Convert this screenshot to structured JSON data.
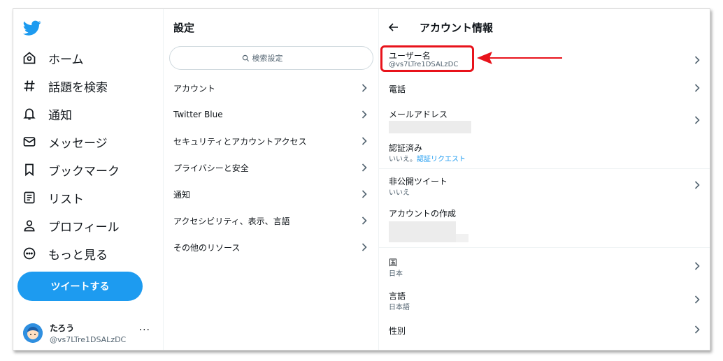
{
  "nav": {
    "items": [
      {
        "label": "ホーム",
        "icon": "home-icon"
      },
      {
        "label": "話題を検索",
        "icon": "hashtag-icon"
      },
      {
        "label": "通知",
        "icon": "bell-icon"
      },
      {
        "label": "メッセージ",
        "icon": "envelope-icon"
      },
      {
        "label": "ブックマーク",
        "icon": "bookmark-icon"
      },
      {
        "label": "リスト",
        "icon": "list-icon"
      },
      {
        "label": "プロフィール",
        "icon": "person-icon"
      },
      {
        "label": "もっと見る",
        "icon": "more-circle-icon"
      }
    ],
    "tweet_button": "ツイートする",
    "account": {
      "name": "たろう",
      "handle": "@vs7LTre1DSALzDC",
      "more": "···"
    }
  },
  "settings": {
    "title": "設定",
    "search_placeholder": "検索設定",
    "items": [
      {
        "label": "アカウント"
      },
      {
        "label": "Twitter Blue"
      },
      {
        "label": "セキュリティとアカウントアクセス"
      },
      {
        "label": "プライバシーと安全"
      },
      {
        "label": "通知"
      },
      {
        "label": "アクセシビリティ、表示、言語"
      },
      {
        "label": "その他のリソース"
      }
    ]
  },
  "account_info": {
    "title": "アカウント情報",
    "username": {
      "label": "ユーザー名",
      "value": "@vs7LTre1DSALzDC"
    },
    "phone": {
      "label": "電話"
    },
    "email": {
      "label": "メールアドレス"
    },
    "verified": {
      "label": "認証済み",
      "value_prefix": "いいえ。",
      "link": "認証リクエスト"
    },
    "protected": {
      "label": "非公開ツイート",
      "value": "いいえ"
    },
    "created": {
      "label": "アカウントの作成"
    },
    "country": {
      "label": "国",
      "value": "日本"
    },
    "language": {
      "label": "言語",
      "value": "日本語"
    },
    "gender": {
      "label": "性別"
    }
  },
  "colors": {
    "accent": "#1d9bf0",
    "highlight": "#e8131b",
    "text": "#0f1419",
    "secondary": "#536471"
  }
}
